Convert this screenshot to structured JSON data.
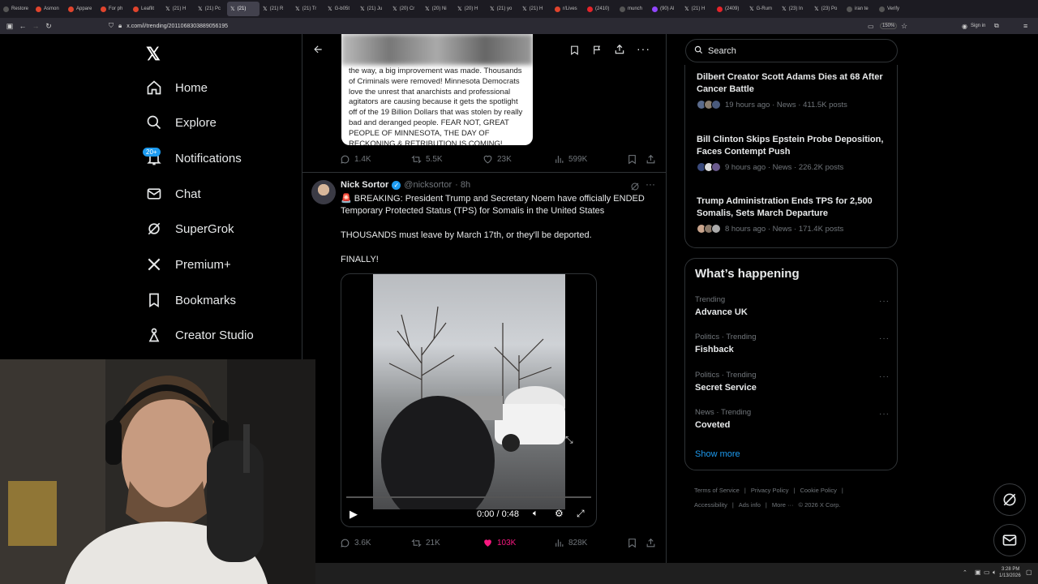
{
  "browser": {
    "tabs": [
      {
        "label": "Restore",
        "icon": "restore-icon"
      },
      {
        "label": "Asmon",
        "icon": "red-icon"
      },
      {
        "label": "Appare",
        "icon": "red-icon"
      },
      {
        "label": "For ph",
        "icon": "red-icon"
      },
      {
        "label": "Leaflit",
        "icon": "red-icon"
      },
      {
        "label": "(21) H",
        "icon": "x-icon"
      },
      {
        "label": "(21) Pc",
        "icon": "x-icon"
      },
      {
        "label": "(21)",
        "icon": "x-icon"
      },
      {
        "label": "(21) R",
        "icon": "x-icon"
      },
      {
        "label": "(21) Tr",
        "icon": "x-icon"
      },
      {
        "label": "G-b05t",
        "icon": "x-icon"
      },
      {
        "label": "(21) Ju",
        "icon": "x-icon"
      },
      {
        "label": "(20) Cr",
        "icon": "x-icon"
      },
      {
        "label": "(20) Ni",
        "icon": "x-icon"
      },
      {
        "label": "(20) H",
        "icon": "x-icon"
      },
      {
        "label": "(21) yo",
        "icon": "x-icon"
      },
      {
        "label": "(21) H",
        "icon": "x-icon"
      },
      {
        "label": "r/Lives",
        "icon": "red-icon"
      },
      {
        "label": "(2410)",
        "icon": "youtube-icon"
      },
      {
        "label": "munch",
        "icon": "globe-icon"
      },
      {
        "label": "(90) Al",
        "icon": "twitch-icon"
      },
      {
        "label": "(21) H",
        "icon": "x-icon"
      },
      {
        "label": "(2409)",
        "icon": "youtube-icon"
      },
      {
        "label": "G-Rum",
        "icon": "x-icon"
      },
      {
        "label": "(23) In",
        "icon": "x-icon"
      },
      {
        "label": "(23) Po",
        "icon": "x-icon"
      },
      {
        "label": "iran te",
        "icon": "globe-icon"
      },
      {
        "label": "Verify",
        "icon": "globe-icon"
      }
    ],
    "url": "x.com/i/trending/2011068303889056195",
    "zoom": "150%",
    "signin": "Sign in"
  },
  "nav": {
    "items": [
      {
        "label": "Home"
      },
      {
        "label": "Explore"
      },
      {
        "label": "Notifications"
      },
      {
        "label": "Chat"
      },
      {
        "label": "SuperGrok"
      },
      {
        "label": "Premium+"
      },
      {
        "label": "Bookmarks"
      },
      {
        "label": "Creator Studio"
      }
    ],
    "notif_badge": "20+"
  },
  "quoted_post": {
    "text": "the way, a big improvement was made. Thousands of Criminals were removed! Minnesota Democrats love the unrest that anarchists and professional agitators are causing because it gets the spotlight off of the 19 Billion Dollars that was stolen by really bad and deranged people. FEAR NOT, GREAT PEOPLE OF MINNESOTA, THE DAY OF RECKONING & RETRIBUTION IS COMING!"
  },
  "post1_stats": {
    "replies": "1.4K",
    "reposts": "5.5K",
    "likes": "23K",
    "views": "599K"
  },
  "post2": {
    "name": "Nick Sortor",
    "handle": "@nicksortor",
    "time": "· 8h",
    "line1": "🚨 BREAKING: President Trump and Secretary Noem have officially ENDED Temporary Protected Status (TPS) for Somalis in the United States",
    "line2": "THOUSANDS must leave by March 17th, or they'll be deported.",
    "line3": "FINALLY!",
    "video_time": "0:00 / 0:48",
    "stats": {
      "replies": "3.6K",
      "reposts": "21K",
      "likes": "103K",
      "views": "828K"
    }
  },
  "search": {
    "placeholder": "Search"
  },
  "news": [
    {
      "title": "Dilbert Creator Scott Adams Dies at 68 After Cancer Battle",
      "meta": "19 hours ago · News · 411.5K posts"
    },
    {
      "title": "Bill Clinton Skips Epstein Probe Deposition, Faces Contempt Push",
      "meta": "9 hours ago · News · 226.2K posts"
    },
    {
      "title": "Trump Administration Ends TPS for 2,500 Somalis, Sets March Departure",
      "meta": "8 hours ago · News · 171.4K posts"
    }
  ],
  "whats_happening": {
    "title": "What’s happening",
    "trends": [
      {
        "category": "Trending",
        "name": "Advance UK"
      },
      {
        "category": "Politics · Trending",
        "name": "Fishback"
      },
      {
        "category": "Politics · Trending",
        "name": "Secret Service"
      },
      {
        "category": "News · Trending",
        "name": "Coveted"
      }
    ],
    "show_more": "Show more"
  },
  "footer": {
    "links": [
      "Terms of Service",
      "|",
      "Privacy Policy",
      "|",
      "Cookie Policy",
      "|",
      "Accessibility",
      "|",
      "Ads info",
      "|",
      "More ···",
      "© 2026 X Corp."
    ]
  },
  "taskbar": {
    "time": "3:28 PM",
    "date": "1/13/2026"
  },
  "colors": {
    "accent": "#1d9bf0",
    "like": "#f91880",
    "bg": "#000000",
    "border": "#2f3336",
    "muted": "#71767b"
  }
}
